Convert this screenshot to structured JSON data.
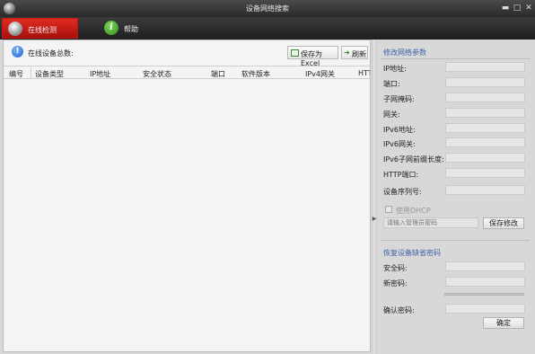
{
  "window": {
    "title": "设备网络搜索",
    "controls": {
      "minimize": "▬",
      "maximize": "□",
      "close": "✕"
    }
  },
  "tabs": [
    {
      "label": "在线检测",
      "icon": "camera-icon",
      "active": true
    },
    {
      "label": "帮助",
      "icon": "info-icon",
      "active": false
    }
  ],
  "summary": {
    "label": "在线设备总数:"
  },
  "toolbar_buttons": {
    "export_excel": "保存为Excel",
    "refresh": "刷新"
  },
  "table": {
    "columns": [
      "编号",
      "设备类型",
      "IP地址",
      "安全状态",
      "端口",
      "软件版本",
      "IPv4网关",
      "HTT"
    ],
    "rows": []
  },
  "modify_params": {
    "title": "修改网络参数",
    "fields": [
      {
        "label": "IP地址:",
        "value": ""
      },
      {
        "label": "端口:",
        "value": ""
      },
      {
        "label": "子网掩码:",
        "value": ""
      },
      {
        "label": "网关:",
        "value": ""
      },
      {
        "label": "IPv6地址:",
        "value": ""
      },
      {
        "label": "IPv6网关:",
        "value": ""
      },
      {
        "label": "IPv6子网前缀长度:",
        "value": ""
      },
      {
        "label": "HTTP端口:",
        "value": ""
      },
      {
        "label": "设备序列号:",
        "value": ""
      }
    ],
    "dhcp_label": "使用DHCP",
    "admin_password_placeholder": "请输入管理员密码",
    "save_button": "保存修改"
  },
  "restore_password": {
    "title": "恢复设备缺省密码",
    "fields": [
      {
        "label": "安全码:",
        "value": ""
      },
      {
        "label": "新密码:",
        "value": ""
      },
      {
        "label": "确认密码:",
        "value": ""
      }
    ],
    "confirm_button": "确定"
  },
  "colors": {
    "active_tab": "#c8160e",
    "section_title": "#3f63a8",
    "titlebar": "#2f2f2f"
  }
}
